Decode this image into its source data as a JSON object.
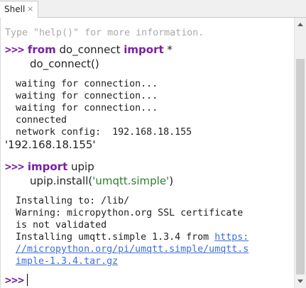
{
  "tab": {
    "label": "Shell",
    "close": "×"
  },
  "shell": {
    "hint": "Type \"help()\" for more information.",
    "prompt": ">>>",
    "cmd1": {
      "kw1": "from",
      "mid": " do_connect ",
      "kw2": "import",
      "tail": " *",
      "line2": "do_connect()"
    },
    "output1": [
      "waiting for connection...",
      "waiting for connection...",
      "waiting for connection...",
      "connected",
      "network config:  192.168.18.155"
    ],
    "result1": "'192.168.18.155'",
    "cmd2": {
      "kw": "import",
      "tail": " upip",
      "line2_pre": "upip.install(",
      "line2_str": "'umqtt.simple'",
      "line2_post": ")"
    },
    "output2": [
      "Installing to: /lib/",
      "Warning: micropython.org SSL certificate",
      "is not validated"
    ],
    "output2_install": "Installing umqtt.simple 1.3.4 from ",
    "link_lines": [
      "https:",
      "//micropython.org/pi/umqtt.simple/umqtt.s",
      "imple-1.3.4.tar.gz"
    ]
  }
}
